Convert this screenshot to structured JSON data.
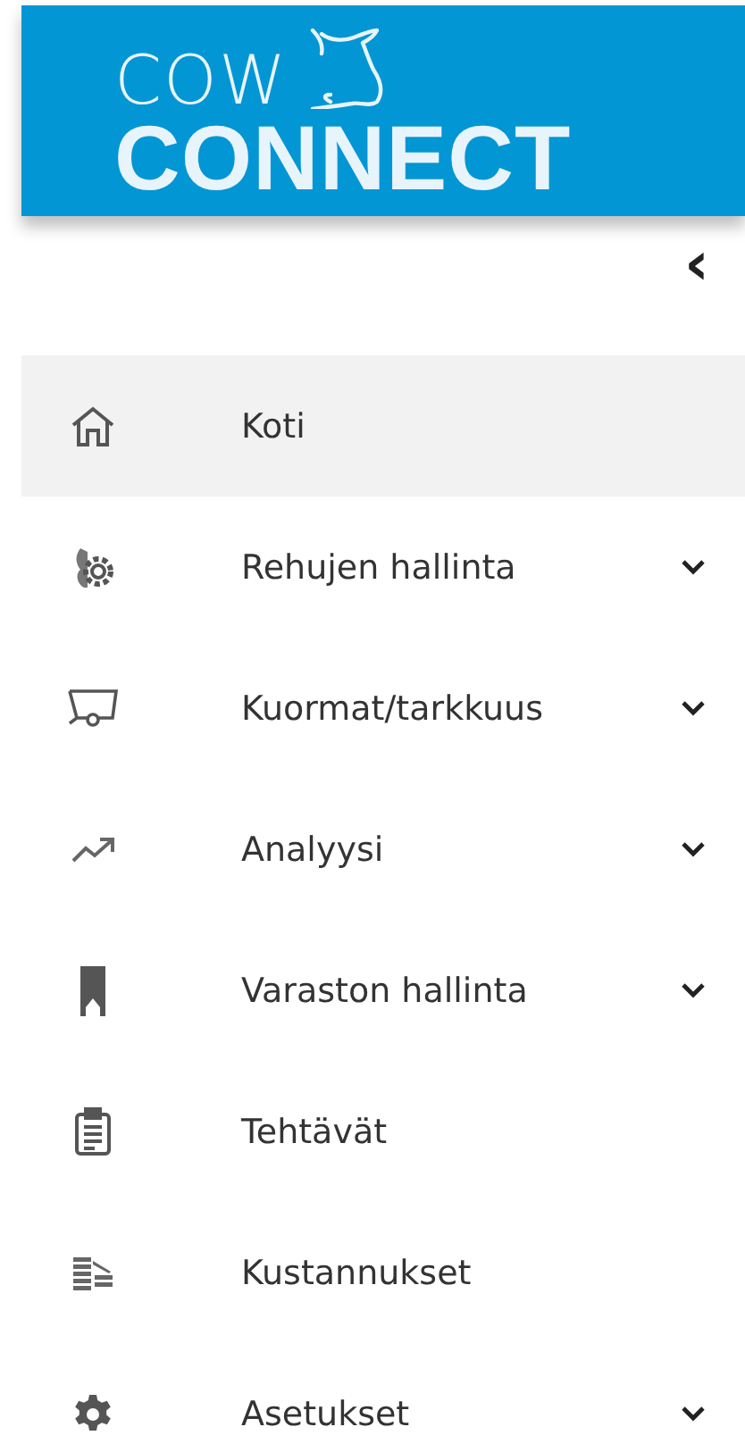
{
  "logo": {
    "top": "COW",
    "bottom": "CONNECT"
  },
  "collapse_button": "‹",
  "menu": [
    {
      "label": "Koti",
      "selected": true,
      "expandable": false
    },
    {
      "label": "Rehujen hallinta",
      "selected": false,
      "expandable": true
    },
    {
      "label": "Kuormat/tarkkuus",
      "selected": false,
      "expandable": true
    },
    {
      "label": "Analyysi",
      "selected": false,
      "expandable": true
    },
    {
      "label": "Varaston hallinta",
      "selected": false,
      "expandable": true
    },
    {
      "label": "Tehtävät",
      "selected": false,
      "expandable": false
    },
    {
      "label": "Kustannukset",
      "selected": false,
      "expandable": false
    },
    {
      "label": "Asetukset",
      "selected": false,
      "expandable": true
    }
  ]
}
